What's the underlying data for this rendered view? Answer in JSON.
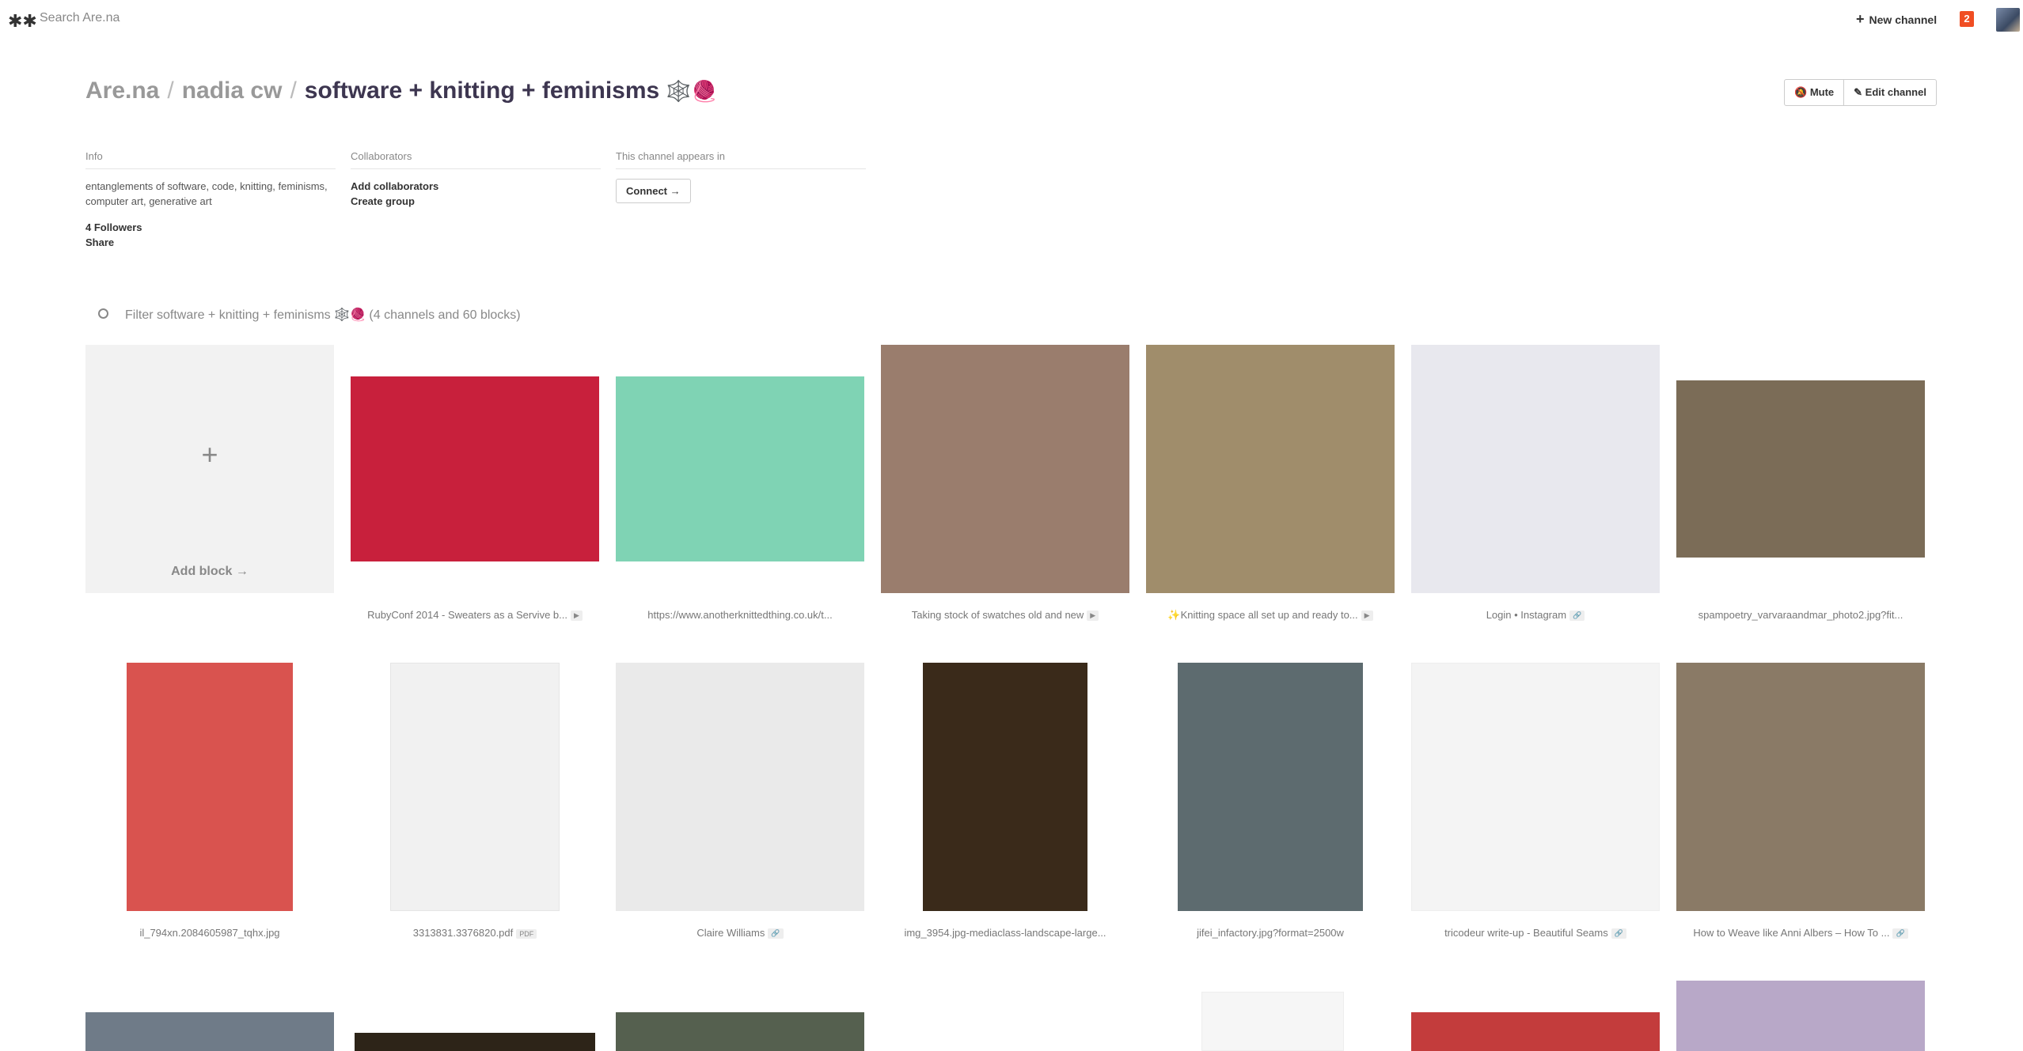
{
  "topbar": {
    "logo": "✱✱",
    "search_placeholder": "Search Are.na",
    "new_channel": "New channel",
    "new_channel_plus": "+",
    "notifications": "2"
  },
  "breadcrumb": {
    "root": "Are.na",
    "user": "nadia cw",
    "channel": "software + knitting + feminisms",
    "emoji": "🕸️🧶",
    "sep": "/"
  },
  "actions": {
    "mute": "Mute",
    "edit": "Edit channel"
  },
  "info": {
    "heading": "Info",
    "description": "entanglements of software, code, knitting, feminisms, computer art, generative art",
    "followers": "4 Followers",
    "share": "Share"
  },
  "collaborators": {
    "heading": "Collaborators",
    "add": "Add collaborators",
    "create_group": "Create group"
  },
  "appears_in": {
    "heading": "This channel appears in",
    "connect": "Connect →"
  },
  "filter": {
    "label": "Filter software + knitting + feminisms",
    "emoji": "🕸️🧶",
    "counts": "(4 channels and 60 blocks)"
  },
  "add_block": {
    "plus": "+",
    "label": "Add block →"
  },
  "row1": [
    {
      "caption": "RubyConf 2014 - Sweaters as a Servive b...",
      "tag": "▶",
      "color": "#c8203c"
    },
    {
      "caption": "https://www.anotherknittedthing.co.uk/t...",
      "tag": "",
      "color": "#7fd3b4"
    },
    {
      "caption": "Taking stock of swatches old and new",
      "tag": "▶",
      "color": "#9a7d6d"
    },
    {
      "caption": "✨Knitting space all set up and ready to...",
      "tag": "▶",
      "color": "#a08d6b"
    },
    {
      "caption": "Login • Instagram",
      "tag": "🔗",
      "color": "#e8e8ee"
    },
    {
      "caption": "spampoetry_varvaraandmar_photo2.jpg?fit...",
      "tag": "",
      "color": "#7b6c57"
    }
  ],
  "row2": [
    {
      "caption": "il_794xn.2084605987_tqhx.jpg",
      "tag": "",
      "color": "#d9534f"
    },
    {
      "caption": "3313831.3376820.pdf",
      "tag": "PDF",
      "color": "#f1f1f1"
    },
    {
      "caption": "Claire Williams",
      "tag": "🔗",
      "color": "#eaeaea"
    },
    {
      "caption": "img_3954.jpg-mediaclass-landscape-large...",
      "tag": "",
      "color": "#3a2a1a"
    },
    {
      "caption": "jifei_infactory.jpg?format=2500w",
      "tag": "",
      "color": "#5d6b6f"
    },
    {
      "caption": "tricodeur write-up - Beautiful Seams",
      "tag": "🔗",
      "color": "#f4f4f4"
    },
    {
      "caption": "How to Weave like Anni Albers – How To ...",
      "tag": "🔗",
      "color": "#8a7a66"
    }
  ],
  "row3_colors": [
    "#6f7b88",
    "#2d2418",
    "#55604f",
    "#f6f6f6",
    "#c33c3c",
    "#b8a8c8"
  ]
}
